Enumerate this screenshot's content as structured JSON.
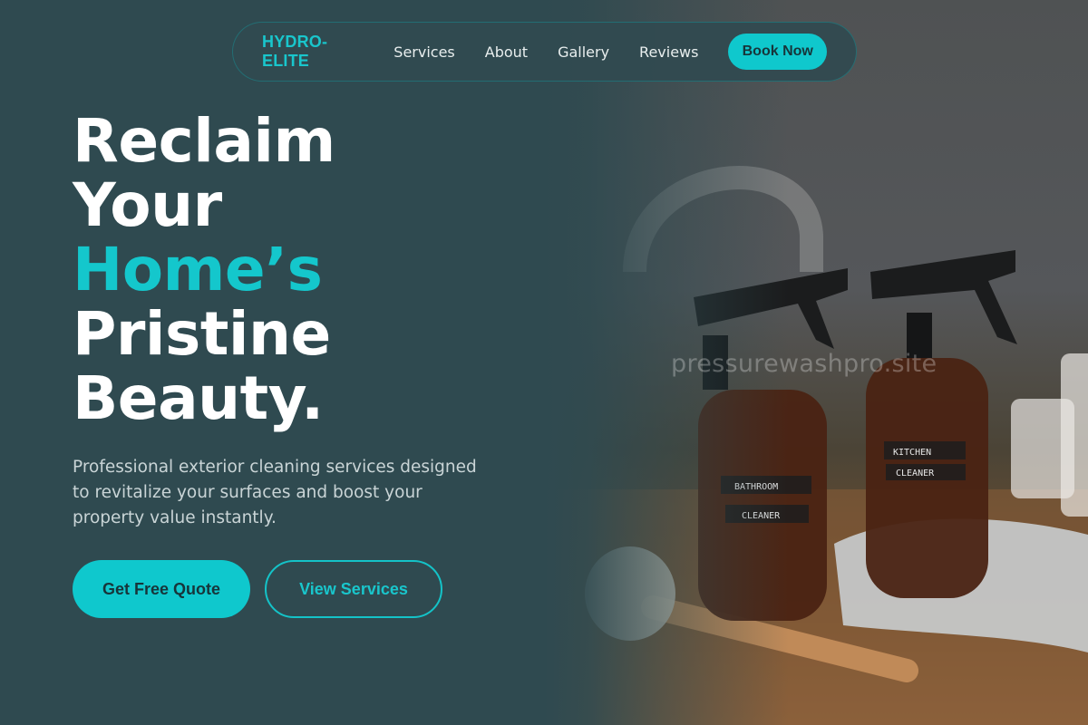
{
  "nav": {
    "brand": "HYDRO-ELITE",
    "links": [
      "Services",
      "About",
      "Gallery",
      "Reviews"
    ],
    "cta": "Book Now"
  },
  "hero": {
    "headline": [
      "Reclaim",
      "Your",
      "Home’s",
      "Pristine",
      "Beauty."
    ],
    "subtitle": "Professional exterior cleaning services designed to revitalize your surfaces and boost your property value instantly.",
    "primary_button": "Get Free Quote",
    "secondary_button": "View Services"
  },
  "photo": {
    "watermark": "pressurewashpro.site",
    "bottle_left_label": [
      "BATHROOM",
      "CLEANER"
    ],
    "bottle_right_label": [
      "KITCHEN",
      "CLEANER"
    ]
  },
  "colors": {
    "background": "#2f4a50",
    "accent": "#0fc8cd",
    "text": "#ffffff"
  }
}
